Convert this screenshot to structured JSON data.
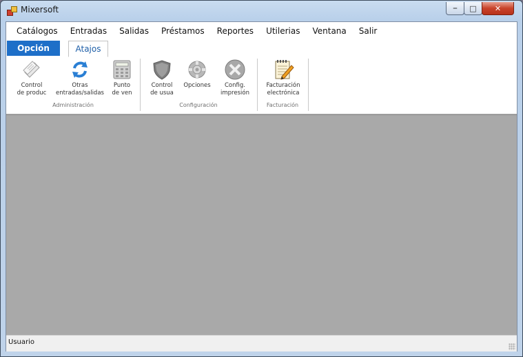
{
  "window": {
    "title": "Mixersoft"
  },
  "window_controls": {
    "minimize_icon": "minimize-icon",
    "maximize_icon": "maximize-icon",
    "close_icon": "close-icon"
  },
  "menu": [
    "Catálogos",
    "Entradas",
    "Salidas",
    "Préstamos",
    "Reportes",
    "Utilerias",
    "Ventana",
    "Salir"
  ],
  "tabs": {
    "opcion": "Opción",
    "atajos": "Atajos"
  },
  "ribbon": {
    "groups": [
      {
        "label": "Administración",
        "buttons": [
          {
            "label": "Control\nde produc",
            "icon": "papers-icon"
          },
          {
            "label": "Otras\nentradas/salidas",
            "icon": "refresh-arrows-icon"
          },
          {
            "label": "Punto\nde ven",
            "icon": "calculator-icon"
          }
        ]
      },
      {
        "label": "Configuración",
        "buttons": [
          {
            "label": "Control\nde usua",
            "icon": "shield-icon"
          },
          {
            "label": "Opciones",
            "icon": "gear-icon"
          },
          {
            "label": "Config.\nimpresión",
            "icon": "tools-icon"
          }
        ]
      },
      {
        "label": "Facturación",
        "buttons": [
          {
            "label": "Facturación\nelectrónica",
            "icon": "notepad-pencil-icon"
          }
        ]
      }
    ]
  },
  "status": {
    "text": "Usuario"
  },
  "colors": {
    "tab_active": "#1e6fc8",
    "mdi_background": "#a9a9a9"
  }
}
